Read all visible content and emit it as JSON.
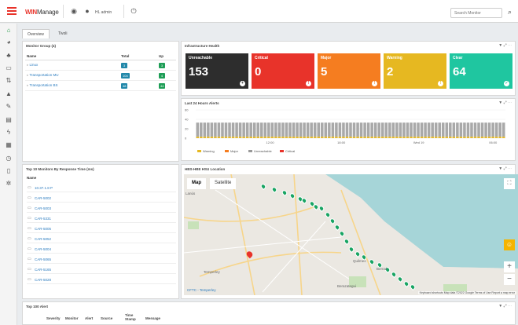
{
  "header": {
    "brand": "WIN",
    "brand_suffix": "Manage",
    "user": "HL admin",
    "search_placeholder": "Search Monitor"
  },
  "tabs": [
    {
      "label": "Overview",
      "active": true
    },
    {
      "label": "Tivoli",
      "active": false
    }
  ],
  "monitor_group": {
    "title": "Monitor Group (4)",
    "columns": [
      "Name",
      "Total",
      "Up"
    ],
    "rows": [
      {
        "name": "Linux",
        "total": "3",
        "up": "3"
      },
      {
        "name": "Transportation MU",
        "total": "104",
        "up": "4"
      },
      {
        "name": "Transportation BS",
        "total": "48",
        "up": "44"
      }
    ]
  },
  "infrastructure": {
    "title": "Infrastructure Health",
    "tiles": [
      {
        "label": "Unreachable",
        "value": "153",
        "color": "#2d2d2d",
        "icon": "+"
      },
      {
        "label": "Critical",
        "value": "0",
        "color": "#e8332a",
        "icon": "!"
      },
      {
        "label": "Major",
        "value": "5",
        "color": "#f57d20",
        "icon": "!"
      },
      {
        "label": "Warning",
        "value": "2",
        "color": "#e6b821",
        "icon": "!"
      },
      {
        "label": "Clear",
        "value": "64",
        "color": "#1fc6a0",
        "icon": "✓"
      }
    ]
  },
  "alerts24": {
    "title": "Last 24 Hours Alerts",
    "legend": [
      "Warning",
      "Major",
      "Unreachable",
      "Critical"
    ],
    "legend_colors": [
      "#e6b821",
      "#f57d20",
      "#999999",
      "#e8332a"
    ]
  },
  "chart_data": {
    "type": "bar",
    "title": "Last 24 Hours Alerts",
    "yticks": [
      "60",
      "40",
      "20",
      "0"
    ],
    "ylim": [
      0,
      60
    ],
    "xticks": [
      "12:00",
      "18:00",
      "Wed 19",
      "06:00"
    ],
    "series": [
      {
        "name": "Unreachable",
        "values": [
          30,
          30,
          30,
          30,
          30,
          30,
          30,
          30,
          30,
          30,
          30,
          30,
          30,
          30,
          30,
          30,
          30,
          30,
          30,
          30,
          30,
          30,
          30,
          30,
          30,
          30,
          30,
          30,
          30,
          30,
          30,
          30,
          30,
          30,
          30,
          30,
          30,
          30,
          30,
          30,
          30,
          30,
          30,
          30,
          30,
          30,
          30,
          30,
          30,
          30,
          30,
          30,
          30,
          30,
          30,
          30,
          30,
          30,
          30,
          30,
          30,
          30,
          30,
          30,
          30,
          30,
          30,
          30,
          30,
          30,
          30,
          30,
          30,
          30,
          30,
          30,
          30,
          30,
          30,
          30,
          30,
          30,
          30,
          30,
          30,
          30,
          30
        ]
      },
      {
        "name": "Warning",
        "values": [
          3,
          3,
          3,
          3,
          3,
          3,
          3,
          3,
          3,
          3,
          3,
          3,
          3,
          3,
          3,
          3,
          3,
          3,
          3,
          3,
          3,
          3,
          3,
          3,
          3,
          3,
          3,
          3,
          3,
          3,
          3,
          3,
          3,
          3,
          3,
          3,
          3,
          3,
          3,
          3,
          3,
          3,
          3,
          3,
          3,
          3,
          3,
          3,
          3,
          3,
          3,
          3,
          3,
          3,
          3,
          3,
          3,
          3,
          3,
          3,
          3,
          3,
          3,
          3,
          3,
          3,
          3,
          3,
          3,
          3,
          3,
          3,
          3,
          3,
          3,
          3,
          3,
          3,
          3,
          3,
          3,
          3,
          3,
          3,
          3,
          3,
          3
        ]
      }
    ]
  },
  "top_monitors": {
    "title": "Top 10 Monitors By Response Time (ms)",
    "column": "Name",
    "items": [
      "10.37.1.8 P",
      "CAR-5002",
      "CAR-5003",
      "CAR-5331",
      "CAR-5005",
      "CAR-5052",
      "CAR-5004",
      "CAR-5065",
      "CAR-5165",
      "CAR-5028"
    ]
  },
  "map_panel": {
    "title": "HBS-HBE HSU Location",
    "btn_map": "Map",
    "btn_satellite": "Satellite",
    "labels": [
      "Lanús",
      "Temperley",
      "Berazategui",
      "Quilmes",
      "Bernal",
      "CFTC - Temperley"
    ],
    "footer": "Keyboard shortcuts   Map data ©2022 Google   Terms of Use   Report a map error"
  },
  "alert_panel": {
    "title": "Top 100 Alert",
    "columns": [
      "Severity",
      "Monitor",
      "Alert",
      "Source",
      "Time Stamp",
      "Message"
    ]
  }
}
